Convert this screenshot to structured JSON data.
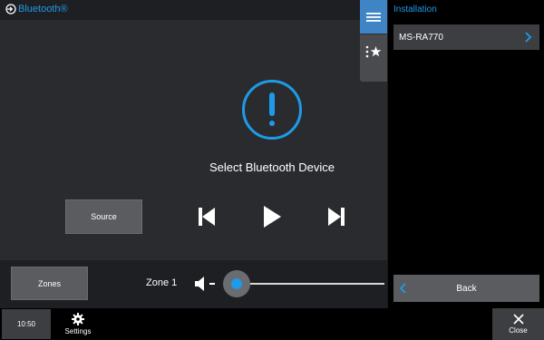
{
  "header": {
    "title": "Bluetooth®"
  },
  "side_tabs": [
    {
      "name": "menu",
      "icon": "hamburger-menu-icon",
      "active": true
    },
    {
      "name": "favorites",
      "icon": "favorites-list-icon",
      "active": false
    }
  ],
  "main": {
    "status_icon": "exclamation-alert-icon",
    "status_text": "Select Bluetooth Device",
    "source_label": "Source",
    "transport": [
      "previous-track-icon",
      "play-icon",
      "next-track-icon"
    ]
  },
  "zone_bar": {
    "zones_label": "Zones",
    "zone_name": "Zone 1",
    "volume_icon": "speaker-mute-icon",
    "volume_level": 0
  },
  "bottom_bar": {
    "time": "10:50",
    "settings_label": "Settings",
    "close_label": "Close"
  },
  "panel": {
    "title": "Installation",
    "items": [
      {
        "label": "MS-RA770"
      }
    ],
    "back_label": "Back"
  },
  "colors": {
    "accent": "#1e9be8",
    "background": "#2a2b2e",
    "button": "#5b5c60",
    "tab_active": "#3f84c4"
  }
}
